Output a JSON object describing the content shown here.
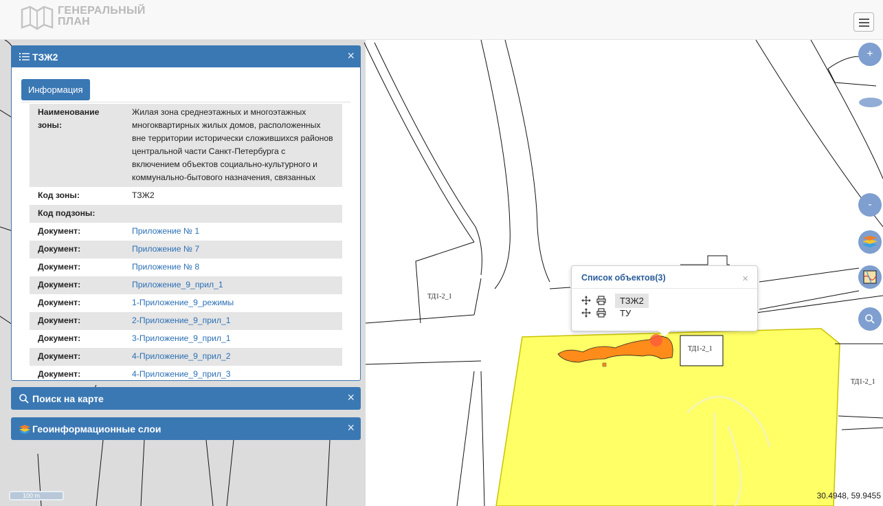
{
  "header": {
    "logo_line1": "ГЕНЕРАЛЬНЫЙ",
    "logo_line2": "ПЛАН"
  },
  "info_panel": {
    "title": "ТЗЖ2",
    "close": "×",
    "tab_label": "Информация",
    "rows": [
      {
        "key": "Наименование зоны:",
        "value": "Жилая зона среднеэтажных и многоэтажных многоквартирных жилых домов, расположенных вне территории исторически сложившихся районов центральной части Санкт-Петербурга с включением объектов социально-культурного и коммунально-бытового назначения, связанных"
      },
      {
        "key": "Код зоны:",
        "value": "ТЗЖ2"
      },
      {
        "key": "Код подзоны:",
        "value": ""
      },
      {
        "key": "Документ:",
        "value": "Приложение № 1"
      },
      {
        "key": "Документ:",
        "value": "Приложение № 7"
      },
      {
        "key": "Документ:",
        "value": "Приложение № 8"
      },
      {
        "key": "Документ:",
        "value": "Приложение_9_прил_1"
      },
      {
        "key": "Документ:",
        "value": "1-Приложение_9_режимы"
      },
      {
        "key": "Документ:",
        "value": "2-Приложение_9_прил_1"
      },
      {
        "key": "Документ:",
        "value": "3-Приложение_9_прил_1"
      },
      {
        "key": "Документ:",
        "value": "4-Приложение_9_прил_2"
      },
      {
        "key": "Документ:",
        "value": "4-Приложение_9_прил_3"
      }
    ]
  },
  "search_panel": {
    "title": "Поиск на карте",
    "close": "×"
  },
  "layers_panel": {
    "title": "Геоинформационные слои",
    "close": "×"
  },
  "map_controls": {
    "zoom_in": "+",
    "zoom_out": "-"
  },
  "popup": {
    "title": "Список объектов(3)",
    "close": "×",
    "items": [
      "ТЗЖ2",
      "ТУ"
    ]
  },
  "map_labels": {
    "label_1": "ТД1-2_1",
    "label_2": "ТД1-2_1",
    "label_3": "ТД1-2_1"
  },
  "scale_label": "100 m",
  "coordinates": "30.4948, 59.9455",
  "colors": {
    "accent": "#3a78b4",
    "zone_fill": "#ffff66",
    "object_fill": "#ff8c1a",
    "map_button": "#7e9fcf"
  }
}
